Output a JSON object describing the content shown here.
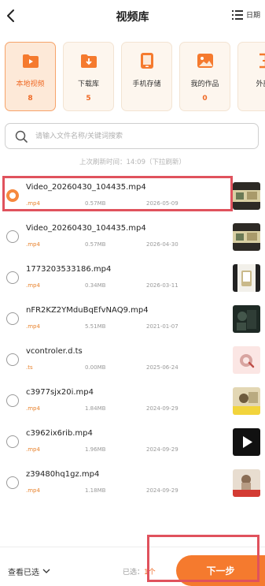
{
  "header": {
    "title": "视频库",
    "sort_label": "日期"
  },
  "categories": [
    {
      "label": "本地视频",
      "count": "8"
    },
    {
      "label": "下载库",
      "count": "5"
    },
    {
      "label": "手机存储",
      "count": ""
    },
    {
      "label": "我的作品",
      "count": "0"
    },
    {
      "label": "外部",
      "count": ""
    }
  ],
  "search": {
    "placeholder": "请输入文件名称/关键词搜索"
  },
  "refresh_text": "上次刷新时间：14:09（下拉刷新）",
  "files": [
    {
      "name": "Video_20260430_104435.mp4",
      "ext": ".mp4",
      "size": "0.57MB",
      "date": "2026-05-09",
      "checked": true
    },
    {
      "name": "Video_20260430_104435.mp4",
      "ext": ".mp4",
      "size": "0.57MB",
      "date": "2026-04-30",
      "checked": false
    },
    {
      "name": "1773203533186.mp4",
      "ext": ".mp4",
      "size": "0.34MB",
      "date": "2026-03-11",
      "checked": false
    },
    {
      "name": "nFR2KZ2YMduBqEfvNAQ9.mp4",
      "ext": ".mp4",
      "size": "5.51MB",
      "date": "2021-01-07",
      "checked": false
    },
    {
      "name": "vcontroler.d.ts",
      "ext": ".ts",
      "size": "0.00MB",
      "date": "2025-06-24",
      "checked": false
    },
    {
      "name": "c3977sjx20i.mp4",
      "ext": ".mp4",
      "size": "1.84MB",
      "date": "2024-09-29",
      "checked": false
    },
    {
      "name": "c3962ix6rib.mp4",
      "ext": ".mp4",
      "size": "1.96MB",
      "date": "2024-09-29",
      "checked": false
    },
    {
      "name": "z39480hq1gz.mp4",
      "ext": ".mp4",
      "size": "1.18MB",
      "date": "2024-09-29",
      "checked": false
    }
  ],
  "bottom": {
    "view_selected_label": "查看已选",
    "selected_label": "已选：",
    "selected_count": "1个",
    "next_label": "下一步"
  },
  "colors": {
    "accent": "#f57a2e",
    "highlight_box": "#e0525d"
  }
}
